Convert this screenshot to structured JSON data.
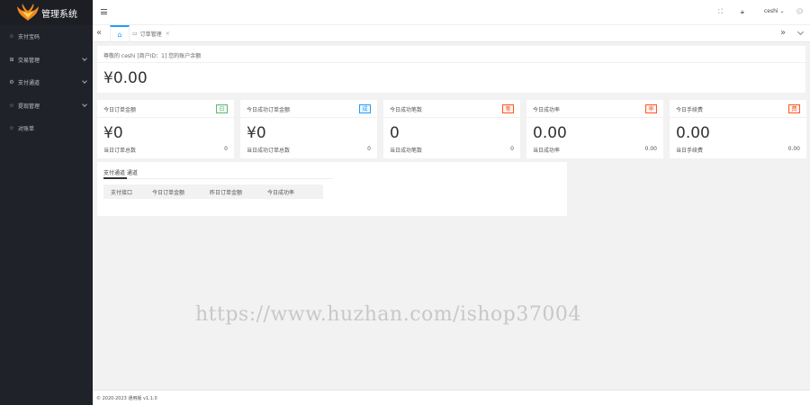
{
  "app": {
    "title": "管理系统",
    "brand_color": "#20222a"
  },
  "sidebar": {
    "items": [
      {
        "label": "支付宝码",
        "icon": "star-icon",
        "has_children": false
      },
      {
        "label": "交易管理",
        "icon": "grid-icon",
        "has_children": true
      },
      {
        "label": "支付通道",
        "icon": "gear-icon",
        "has_children": true
      },
      {
        "label": "提现管理",
        "icon": "star-icon",
        "has_children": true
      },
      {
        "label": "对账单",
        "icon": "star-icon",
        "has_children": false
      }
    ]
  },
  "header": {
    "user_name": "ceshi"
  },
  "tabs": {
    "home_icon": "home-icon",
    "open": [
      {
        "label": "订单管理"
      }
    ]
  },
  "balance": {
    "label": "尊敬的 ceshi [商户ID：1] 您的账户余额",
    "amount": "¥0.00"
  },
  "cards": [
    {
      "title": "今日订单金额",
      "badge": "日",
      "badge_color": "green",
      "value": "¥0",
      "sub_label": "当日订单总数",
      "sub_value": "0"
    },
    {
      "title": "今日成功订单金额",
      "badge": "成",
      "badge_color": "blue",
      "value": "¥0",
      "sub_label": "当日成功订单总数",
      "sub_value": "0"
    },
    {
      "title": "今日成功笔数",
      "badge": "笔",
      "badge_color": "red",
      "value": "0",
      "sub_label": "当日成功笔数",
      "sub_value": "0"
    },
    {
      "title": "今日成功率",
      "badge": "率",
      "badge_color": "red",
      "value": "0.00",
      "sub_label": "当日成功率",
      "sub_value": "0.00"
    },
    {
      "title": "今日手续费",
      "badge": "费",
      "badge_color": "red",
      "value": "0.00",
      "sub_label": "当日手续费",
      "sub_value": "0.00"
    }
  ],
  "channel": {
    "tabs_label": "支付通道 通道",
    "columns": [
      "支付接口",
      "今日订单金额",
      "昨日订单金额",
      "今日成功率"
    ]
  },
  "footer": {
    "text": "© 2020-2023 通用版 v1.1.0"
  },
  "watermark": {
    "text": "https://www.huzhan.com/ishop37004"
  }
}
